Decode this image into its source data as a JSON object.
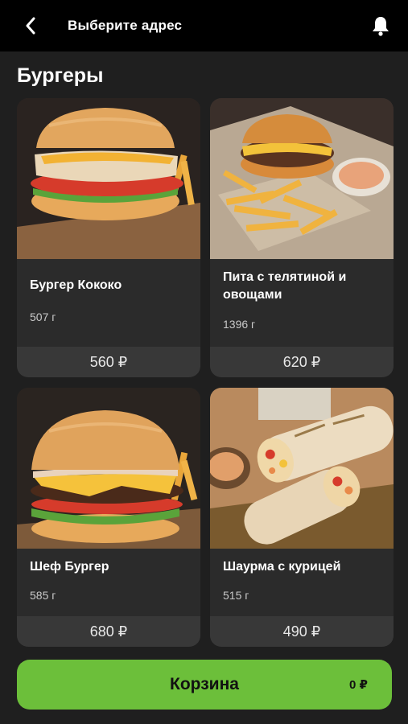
{
  "header": {
    "title": "Выберите адрес"
  },
  "section": {
    "title": "Бургеры"
  },
  "products": [
    {
      "name": "Бургер Кококо",
      "weight": "507 г",
      "price": "560 ₽",
      "image": "burger-chicken-photo"
    },
    {
      "name": "Пита с телятиной и овощами",
      "weight": "1396 г",
      "price": "620 ₽",
      "image": "burger-fries-sauce-photo"
    },
    {
      "name": "Шеф Бургер",
      "weight": "585 г",
      "price": "680 ₽",
      "image": "burger-beef-cheese-photo"
    },
    {
      "name": "Шаурма с курицей",
      "weight": "515 г",
      "price": "490 ₽",
      "image": "shawarma-photo"
    }
  ],
  "cart": {
    "label": "Корзина",
    "total": "0 ₽"
  },
  "colors": {
    "accent": "#6cbf3a",
    "background": "#1f1f1f",
    "card": "#2b2b2b",
    "price_bar": "#383838"
  }
}
